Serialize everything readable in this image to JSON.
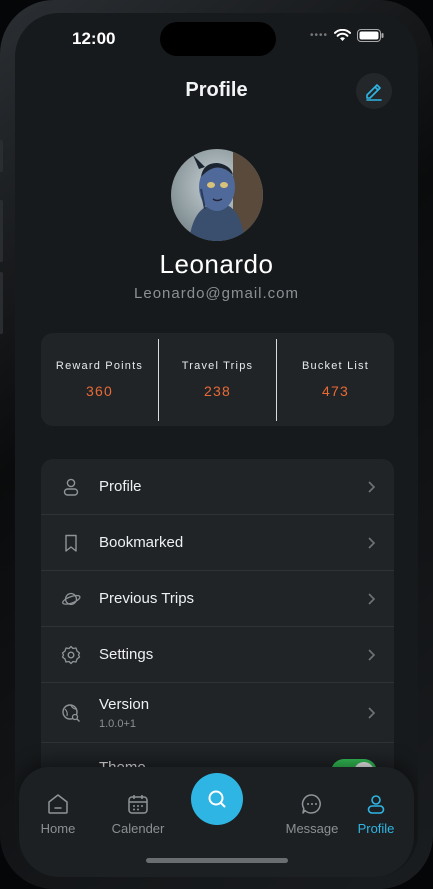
{
  "status_bar": {
    "time": "12:00"
  },
  "header": {
    "title": "Profile"
  },
  "user": {
    "name": "Leonardo",
    "email": "Leonardo@gmail.com"
  },
  "stats": [
    {
      "label": "Reward Points",
      "value": "360"
    },
    {
      "label": "Travel Trips",
      "value": "238"
    },
    {
      "label": "Bucket List",
      "value": "473"
    }
  ],
  "menu": {
    "items": [
      {
        "label": "Profile",
        "icon": "user-icon"
      },
      {
        "label": "Bookmarked",
        "icon": "bookmark-icon"
      },
      {
        "label": "Previous Trips",
        "icon": "planet-icon"
      },
      {
        "label": "Settings",
        "icon": "gear-icon"
      },
      {
        "label": "Version",
        "sublabel": "1.0.0+1",
        "icon": "globe-search-icon"
      },
      {
        "label": "Theme",
        "icon": "sun-icon",
        "toggle_on": true
      }
    ]
  },
  "tabbar": {
    "tabs": [
      {
        "label": "Home",
        "icon": "home-icon"
      },
      {
        "label": "Calender",
        "icon": "calendar-icon"
      },
      {
        "label": "Message",
        "icon": "chat-icon"
      },
      {
        "label": "Profile",
        "icon": "user-icon",
        "active": true
      }
    ],
    "fab_icon": "search-icon"
  },
  "colors": {
    "accent": "#2fb5e3",
    "stat_value": "#e86a36",
    "toggle_on": "#35c759",
    "background": "#171a1c",
    "card": "#202427"
  }
}
